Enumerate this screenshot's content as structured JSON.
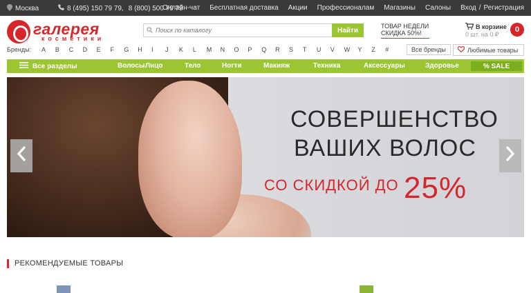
{
  "topbar": {
    "city": "Москва",
    "phone1": "8 (495) 150 79 79,",
    "phone2": "8 (800) 500 79 79",
    "links": [
      "Онлайн-чат",
      "Бесплатная доставка",
      "Акции",
      "Профессионалам",
      "Магазины",
      "Салоны"
    ],
    "login": "Вход",
    "separator": "/",
    "register": "Регистрация"
  },
  "logo": {
    "name": "галерея",
    "sub": "косметики"
  },
  "search": {
    "placeholder": "Поиск по каталогу",
    "button": "Найти"
  },
  "promo": {
    "line1": "ТОВАР НЕДЕЛИ",
    "line2": "СКИДКА 50%!"
  },
  "cart": {
    "title": "В корзине",
    "summary": "0 шт. на 0 ₽",
    "count": "0"
  },
  "brands": {
    "label": "Бренды:",
    "letters": [
      "A",
      "B",
      "C",
      "D",
      "E",
      "F",
      "G",
      "H",
      "I",
      "J",
      "K",
      "L",
      "M",
      "N",
      "O",
      "P",
      "Q",
      "R",
      "S",
      "T",
      "U",
      "V",
      "W",
      "Y",
      "Z",
      "#"
    ],
    "all_brands": "Все бренды",
    "favorite": "Любимые товары"
  },
  "nav": {
    "all_sections": "Все разделы",
    "items": [
      "Волосы",
      "Лицо",
      "Тело",
      "Ногти",
      "Макияж",
      "Техника",
      "Аксессуары",
      "Здоровье"
    ],
    "sale": "% SALE"
  },
  "banner": {
    "line1": "СОВЕРШЕНСТВО",
    "line2": "ВАШИХ ВОЛОС",
    "line3": "СО СКИДКОЙ ДО",
    "discount": "25%"
  },
  "recommended": {
    "title": "РЕКОМЕНДУЕМЫЕ ТОВАРЫ"
  },
  "colors": {
    "accent_red": "#d6262b",
    "accent_green": "#9cc533",
    "topbar_bg": "#3a3a3a"
  }
}
